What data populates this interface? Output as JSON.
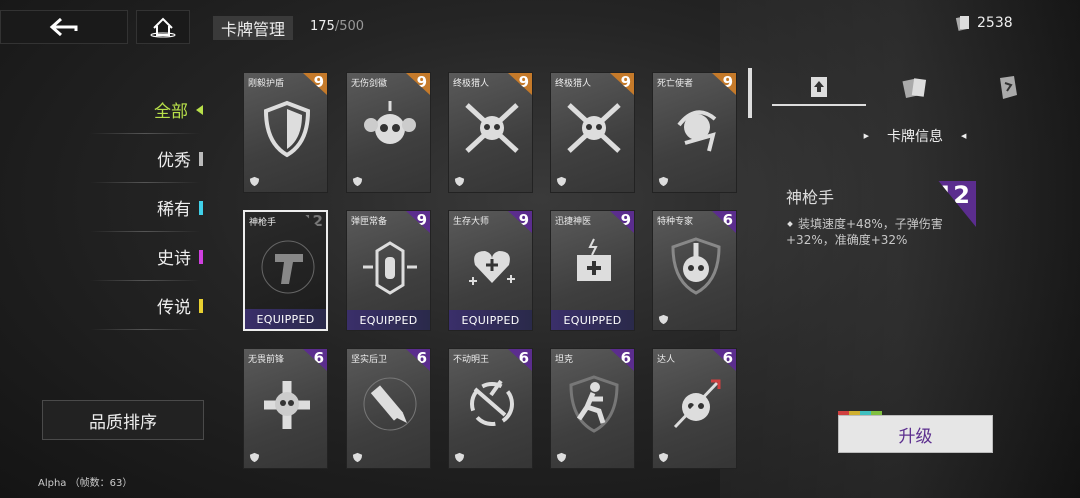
{
  "header": {
    "title": "卡牌管理",
    "count": "175",
    "count_max": "/500",
    "currency": "2538"
  },
  "nav": [
    {
      "label": "全部",
      "color": "#b8e04a",
      "active": true
    },
    {
      "label": "优秀",
      "color": "#bbbbbb"
    },
    {
      "label": "稀有",
      "color": "#40d0e8"
    },
    {
      "label": "史诗",
      "color": "#d040e0"
    },
    {
      "label": "传说",
      "color": "#e8d030"
    }
  ],
  "sort_label": "品质排序",
  "cards": [
    {
      "name": "刚毅护盾",
      "level": "9",
      "tier": "orange",
      "icon": "shield-icon"
    },
    {
      "name": "无伤剑徽",
      "level": "9",
      "tier": "orange",
      "icon": "skull-crest-icon"
    },
    {
      "name": "终极猎人",
      "level": "9",
      "tier": "orange",
      "icon": "hunter-skull-icon"
    },
    {
      "name": "终极猎人",
      "level": "9",
      "tier": "orange",
      "icon": "hunter-skull-icon"
    },
    {
      "name": "死亡使者",
      "level": "9",
      "tier": "orange",
      "icon": "reaper-icon"
    },
    {
      "name": "神枪手",
      "level": "12",
      "tier": "none",
      "icon": "pistol-icon",
      "equipped": "EQUIPPED"
    },
    {
      "name": "弹匣常备",
      "level": "9",
      "tier": "purple",
      "icon": "ammo-icon",
      "equipped": "EQUIPPED"
    },
    {
      "name": "生存大师",
      "level": "9",
      "tier": "purple",
      "icon": "heart-plus-icon",
      "equipped": "EQUIPPED"
    },
    {
      "name": "迅捷神医",
      "level": "9",
      "tier": "purple",
      "icon": "medkit-icon",
      "equipped": "EQUIPPED"
    },
    {
      "name": "特种专家",
      "level": "6",
      "tier": "purple",
      "icon": "mohawk-skull-icon"
    },
    {
      "name": "无畏前锋",
      "level": "6",
      "tier": "purple",
      "icon": "skull-cross-icon"
    },
    {
      "name": "坚实后卫",
      "level": "6",
      "tier": "purple",
      "icon": "syringe-icon"
    },
    {
      "name": "不动明王",
      "level": "6",
      "tier": "purple",
      "icon": "deflect-icon"
    },
    {
      "name": "坦克",
      "level": "6",
      "tier": "purple",
      "icon": "tank-runner-icon"
    },
    {
      "name": "达人",
      "level": "6",
      "tier": "purple",
      "icon": "arrow-skull-icon"
    }
  ],
  "panel": {
    "info_tab": "卡牌信息",
    "card_name": "神枪手",
    "card_level": "12",
    "desc": "装填速度+48%，子弹伤害+32%，准确度+32%",
    "upgrade_label": "升级"
  },
  "debug": "Alpha （帧数：63）"
}
